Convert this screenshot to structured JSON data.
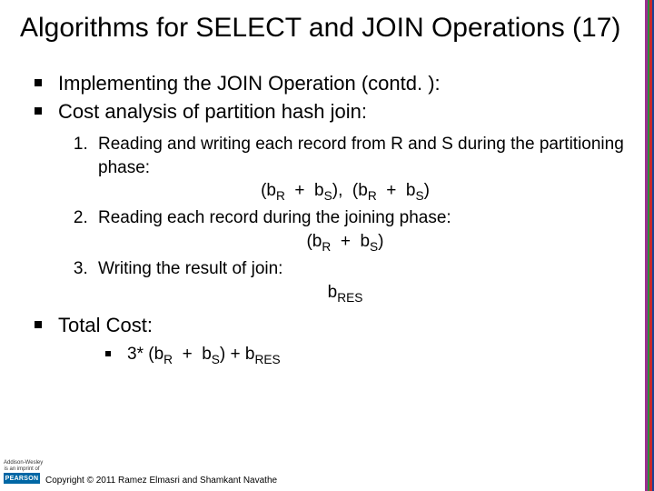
{
  "title": "Algorithms for SELECT and JOIN Operations (17)",
  "mainBullets": [
    "Implementing the JOIN Operation (contd. ):",
    "Cost analysis of partition hash join:"
  ],
  "numbered": [
    {
      "text": "Reading and writing each record from R and S during the partitioning phase:",
      "formula_html": "(b<span class='sub'>R</span>&nbsp; +&nbsp; b<span class='sub'>S</span>),&nbsp; (b<span class='sub'>R</span>&nbsp; +&nbsp; b<span class='sub'>S</span>)"
    },
    {
      "text": "Reading each record during the joining phase:",
      "formula_html": "(b<span class='sub'>R</span>&nbsp; +&nbsp; b<span class='sub'>S</span>)"
    },
    {
      "text": "Writing the result of join:",
      "formula_html": "b<span class='sub'>RES</span>"
    }
  ],
  "totalLabel": "Total Cost:",
  "totalFormula_html": "3* (b<span class='sub'>R</span>&nbsp; +&nbsp; b<span class='sub'>S</span>) + b<span class='sub'>RES</span>",
  "copyright": "Copyright © 2011 Ramez Elmasri and Shamkant Navathe",
  "logo": {
    "top": "Addison-Wesley",
    "sub": "is an imprint of",
    "brand": "PEARSON"
  }
}
